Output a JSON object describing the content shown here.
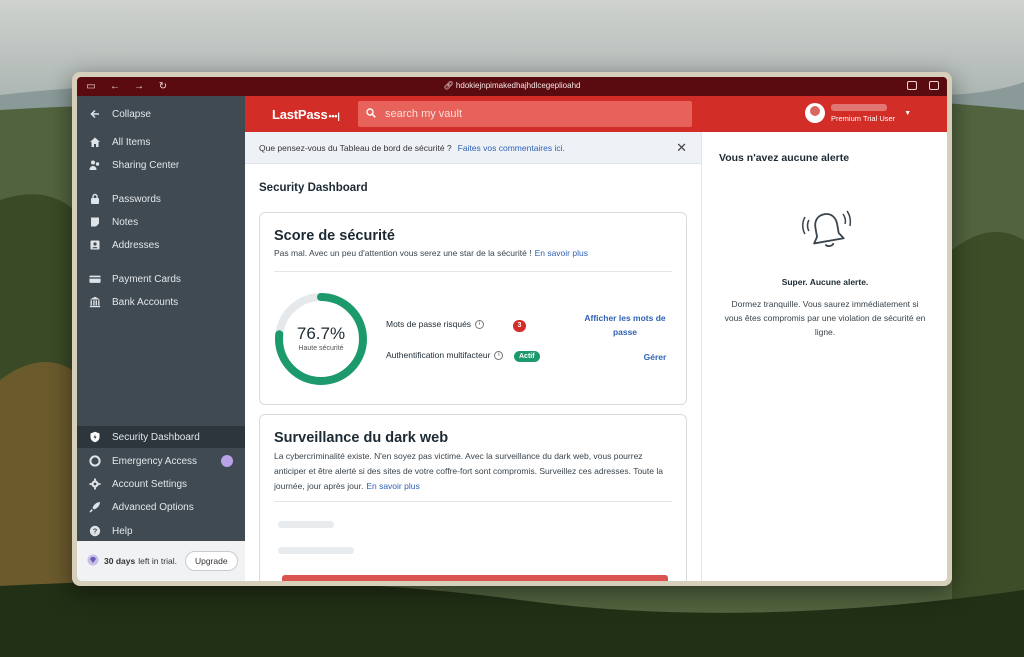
{
  "browser": {
    "url": "hdokiejnpimakedhajhdlcegeplioahd"
  },
  "sidebar": {
    "collapse_label": "Collapse",
    "items": [
      {
        "label": "All Items",
        "icon": "home-icon"
      },
      {
        "label": "Sharing Center",
        "icon": "sharing-icon"
      },
      {
        "label": "Passwords",
        "icon": "lock-icon"
      },
      {
        "label": "Notes",
        "icon": "note-icon"
      },
      {
        "label": "Addresses",
        "icon": "address-icon"
      },
      {
        "label": "Payment Cards",
        "icon": "card-icon"
      },
      {
        "label": "Bank Accounts",
        "icon": "bank-icon"
      }
    ],
    "bottom_items": [
      {
        "label": "Security Dashboard",
        "icon": "shield-icon"
      },
      {
        "label": "Emergency Access",
        "icon": "lifebuoy-icon"
      },
      {
        "label": "Account Settings",
        "icon": "gear-icon"
      },
      {
        "label": "Advanced Options",
        "icon": "rocket-icon"
      },
      {
        "label": "Help",
        "icon": "help-icon"
      }
    ],
    "trial": {
      "days": "30 days",
      "suffix": "left in trial.",
      "upgrade_label": "Upgrade"
    }
  },
  "topbar": {
    "logo": "LastPass",
    "logo_dots": "•••|",
    "search_placeholder": "search my vault",
    "user_plan": "Premium Trial User",
    "brand_color": "#d32d27"
  },
  "banner": {
    "text": "Que pensez-vous du Tableau de bord de sécurité ?",
    "link": "Faites vos commentaires ici."
  },
  "page_title": "Security Dashboard",
  "score_card": {
    "title": "Score de sécurité",
    "desc": "Pas mal. Avec un peu d'attention vous serez une star de la sécurité !",
    "link": "En savoir plus",
    "score_text": "76.7%",
    "score_value": 0.767,
    "score_label": "Haute sécurité",
    "metrics": [
      {
        "label": "Mots de passe risqués",
        "badge": "3",
        "action": "Afficher les mots de passe"
      },
      {
        "label": "Authentification multifacteur",
        "badge": "Actif",
        "action": "Gérer"
      }
    ],
    "accent_color": "#1d9a6c"
  },
  "darkweb_card": {
    "title": "Surveillance du dark web",
    "desc": "La cybercriminalité existe. N'en soyez pas victime. Avec la surveillance du dark web, vous pourrez anticiper et être alerté si des sites de votre coffre-fort sont compromis. Surveillez ces adresses. Toute la journée, jour après jour.",
    "link": "En savoir plus"
  },
  "alerts": {
    "title": "Vous n'avez aucune alerte",
    "subtitle": "Super. Aucune alerte.",
    "text": "Dormez tranquille. Vous saurez immédiatement si vous êtes compromis par une violation de sécurité en ligne."
  }
}
